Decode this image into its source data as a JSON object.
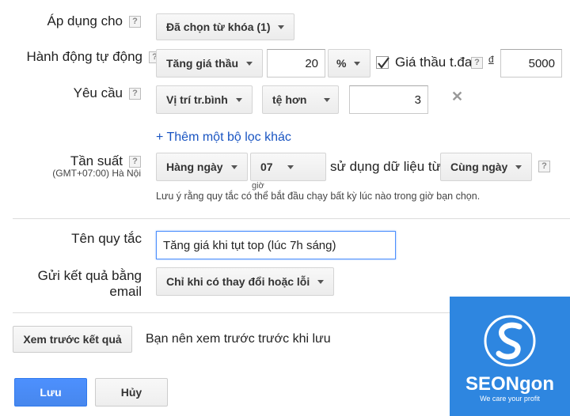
{
  "rows": {
    "apply_to": {
      "label": "Áp dụng cho",
      "value": "Đã chọn từ khóa (1)"
    },
    "auto_action": {
      "label": "Hành động tự động",
      "action": "Tăng giá thầu",
      "amount": "20",
      "unit": "%",
      "max_bid_checked": true,
      "max_bid_label": "Giá thầu t.đa",
      "currency": "đ",
      "max_bid_value": "5000"
    },
    "requirement": {
      "label": "Yêu cầu",
      "metric": "Vị trí tr.bình",
      "operator": "tệ hơn",
      "value": "3"
    },
    "add_filter": "+ Thêm một bộ lọc khác",
    "frequency": {
      "label": "Tần suất",
      "timezone": "(GMT+07:00) Hà Nội",
      "period": "Hàng ngày",
      "hour": "07",
      "hour_caption": "giờ",
      "use_data_text": "sử dụng dữ liệu từ",
      "data_range": "Cùng ngày",
      "note": "Lưu ý rằng quy tắc có thể bắt đầu chạy bất kỳ lúc nào trong giờ bạn chọn."
    },
    "rule_name": {
      "label": "Tên quy tắc",
      "value": "Tăng giá khi tụt top (lúc 7h sáng)"
    },
    "email": {
      "label_line1": "Gửi kết quả bằng",
      "label_line2": "email",
      "value": "Chỉ khi có thay đổi hoặc lỗi"
    }
  },
  "preview": {
    "button": "Xem trước kết quả",
    "hint": "Bạn nên xem trước trước khi lưu"
  },
  "footer": {
    "save": "Lưu",
    "cancel": "Hủy"
  },
  "help_glyph": "?",
  "remove_glyph": "✕",
  "logo": {
    "name": "SEONgon",
    "tagline": "We care your profit",
    "color": "#2e86e0"
  }
}
